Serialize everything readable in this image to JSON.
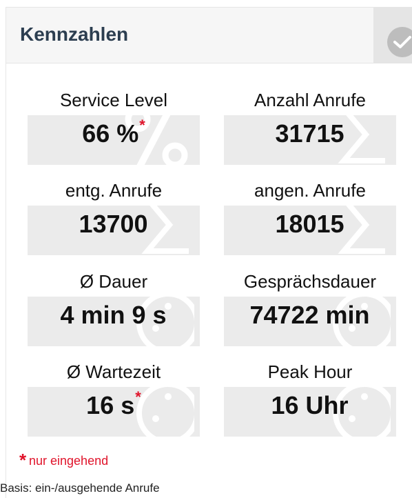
{
  "panel": {
    "title": "Kennzahlen",
    "toggle_icon": "check-icon"
  },
  "tiles": [
    {
      "label": "Service Level",
      "value": "66 %",
      "marker": "*",
      "icon": "percent-icon"
    },
    {
      "label": "Anzahl Anrufe",
      "value": "31715",
      "marker": "",
      "icon": "sigma-icon"
    },
    {
      "label": "entg. Anrufe",
      "value": "13700",
      "marker": "",
      "icon": "sigma-icon"
    },
    {
      "label": "angen. Anrufe",
      "value": "18015",
      "marker": "",
      "icon": "sigma-icon"
    },
    {
      "label": "Ø Dauer",
      "value": "4 min 9 s",
      "marker": "",
      "icon": "stopwatch-icon"
    },
    {
      "label": "Gesprächsdauer",
      "value": "74722 min",
      "marker": "",
      "icon": "stopwatch-icon"
    },
    {
      "label": "Ø Wartezeit",
      "value": "16 s",
      "marker": "*",
      "icon": "stopwatch-icon"
    },
    {
      "label": "Peak Hour",
      "value": "16 Uhr",
      "marker": "",
      "icon": "stopwatch-icon"
    }
  ],
  "footer": {
    "marker": "*",
    "note": "nur eingehend",
    "basis": "Basis: ein-/ausgehende Anrufe"
  },
  "colors": {
    "accent_red": "#e0132a",
    "title_color": "#2c3e50",
    "tile_bg": "#ebebeb"
  }
}
